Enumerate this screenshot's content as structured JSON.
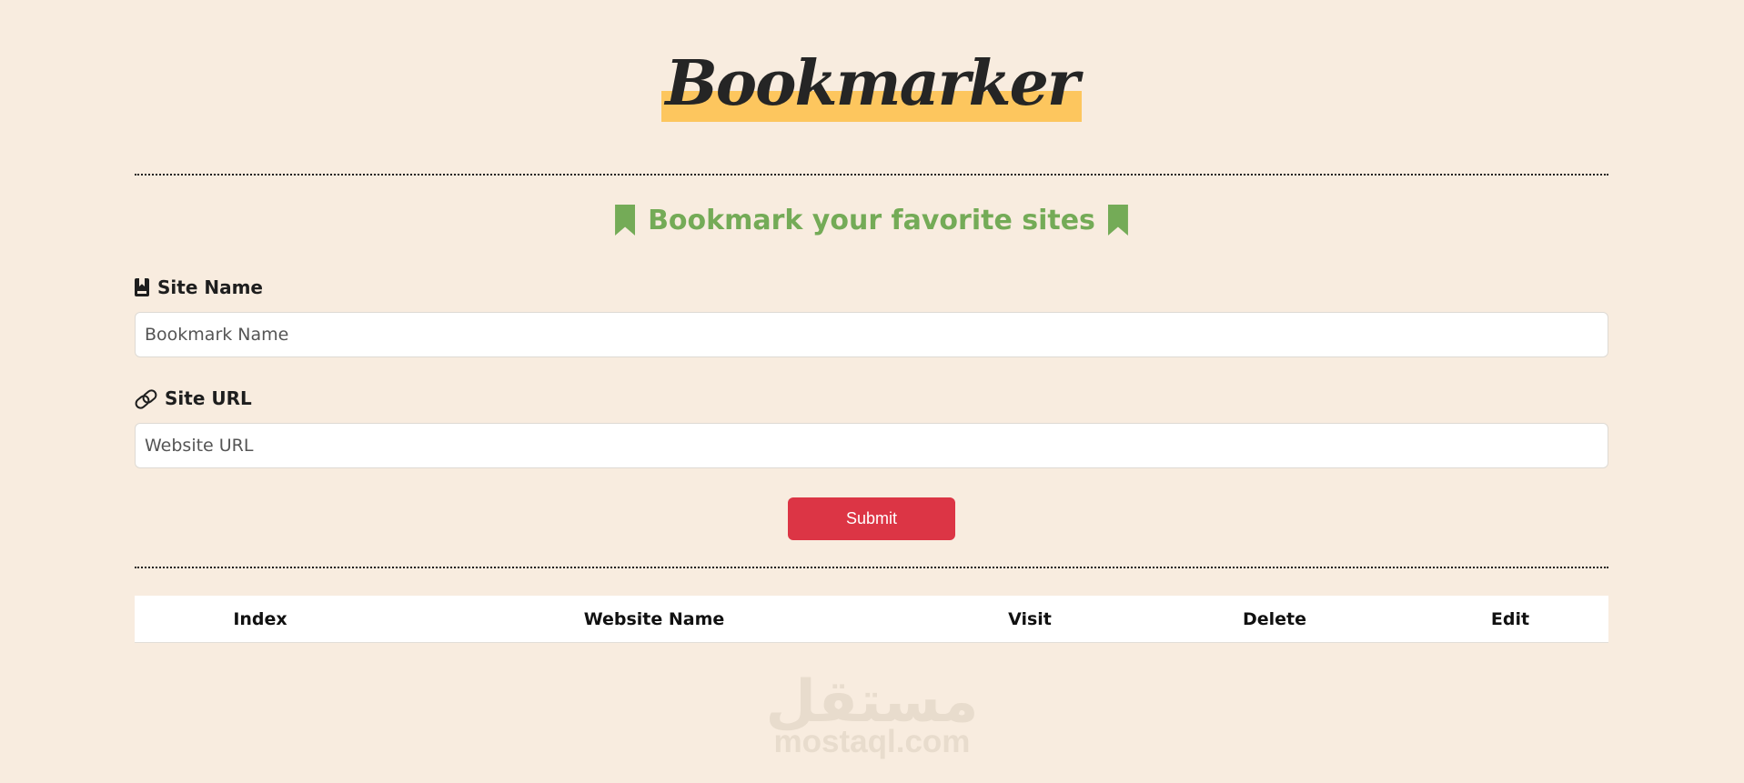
{
  "header": {
    "logo_text": "Bookmarker"
  },
  "subtitle": {
    "text": "Bookmark your favorite sites",
    "icon": "bookmark-icon",
    "color": "#74ab57"
  },
  "form": {
    "site_name": {
      "label": "Site Name",
      "icon": "book-bookmark-icon",
      "placeholder": "Bookmark Name",
      "value": ""
    },
    "site_url": {
      "label": "Site URL",
      "icon": "link-icon",
      "placeholder": "Website URL",
      "value": ""
    },
    "submit_label": "Submit",
    "submit_color": "#dc3545"
  },
  "table": {
    "headers": [
      "Index",
      "Website Name",
      "Visit",
      "Delete",
      "Edit"
    ],
    "rows": []
  },
  "watermark": {
    "arabic": "مستقل",
    "latin": "mostaql.com"
  },
  "colors": {
    "background": "#f8ecdf",
    "logo_highlight": "#fdc65e"
  }
}
